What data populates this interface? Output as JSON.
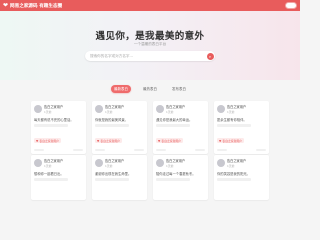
{
  "topbar": {
    "icon": "heart-icon",
    "brand": "网易之家源码 有趣生态圈",
    "accent": "#e85c5c"
  },
  "hero": {
    "title": "遇见你，是我最美的意外",
    "subtitle": "一个温暖的表白平台",
    "search": {
      "placeholder": "搜索你的名字或对方名字…"
    }
  },
  "tabs": [
    {
      "label": "最新表白",
      "active": true
    },
    {
      "label": "最热表白",
      "active": false
    },
    {
      "label": "发布表白",
      "active": false
    }
  ],
  "cards": [
    {
      "name": "告白之家用户",
      "meta": "1天前",
      "text": "每天都有说不完的心里话。",
      "tag": "♥ 表白之家新用户"
    },
    {
      "name": "告白之家用户",
      "meta": "1天前",
      "text": "你就是我的最美风景。",
      "tag": "♥ 表白之家新用户"
    },
    {
      "name": "告白之家用户",
      "meta": "1天前",
      "text": "遇见你是我最大的幸运。",
      "tag": "♥ 表白之家新用户"
    },
    {
      "name": "告白之家用户",
      "meta": "1天前",
      "text": "愿余生都有你相伴。",
      "tag": "♥ 表白之家新用户"
    },
    {
      "name": "告白之家用户",
      "meta": "1天前",
      "text": "想和你一起看日出。",
      "tag": ""
    },
    {
      "name": "告白之家用户",
      "meta": "1天前",
      "text": "谢谢你出现在我生命里。",
      "tag": ""
    },
    {
      "name": "告白之家用户",
      "meta": "1天前",
      "text": "陪你走过每一个春夏秋冬。",
      "tag": ""
    },
    {
      "name": "告白之家用户",
      "meta": "1天前",
      "text": "你的笑容是我的阳光。",
      "tag": ""
    }
  ]
}
